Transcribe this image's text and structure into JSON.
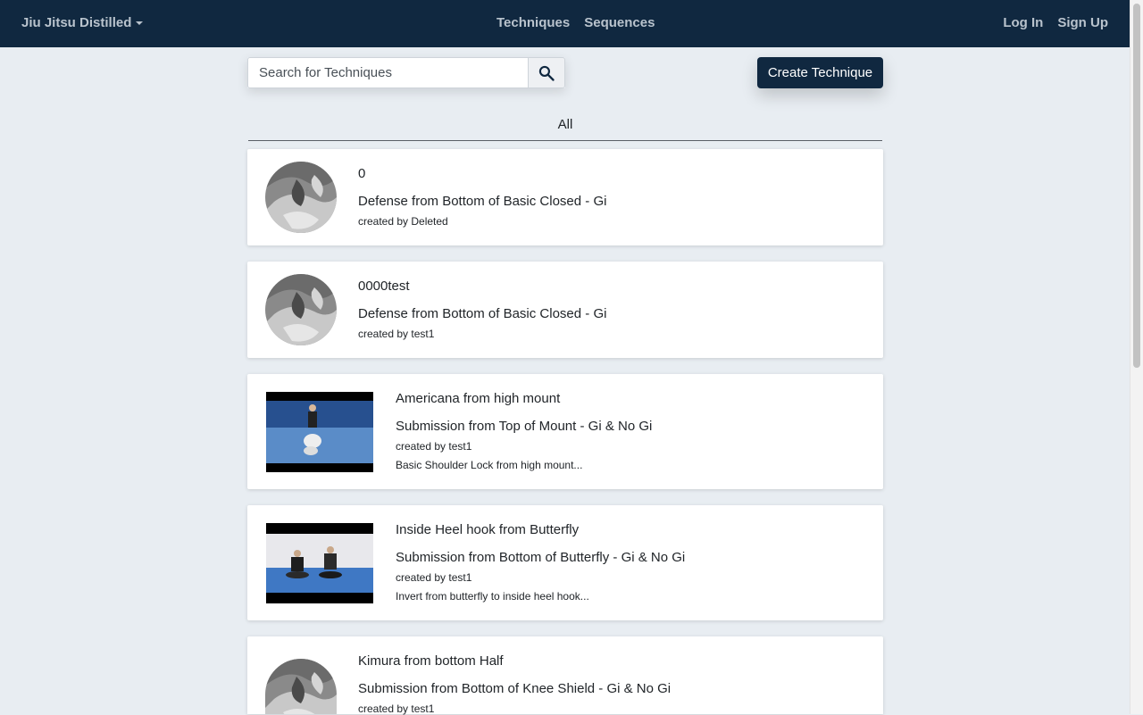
{
  "navbar": {
    "brand": "Jiu Jitsu Distilled",
    "center_links": [
      "Techniques",
      "Sequences"
    ],
    "right_links": [
      "Log In",
      "Sign Up"
    ],
    "bg_color": "#102840"
  },
  "search": {
    "placeholder": "Search for Techniques",
    "button_icon": "search-icon"
  },
  "create_button": "Create Technique",
  "filter_tab": "All",
  "techniques": [
    {
      "name": "0",
      "category": "Defense from Bottom of Basic Closed - Gi",
      "created_by": "created by Deleted",
      "description": "",
      "thumbnail": "grayscale-avatar"
    },
    {
      "name": "0000test",
      "category": "Defense from Bottom of Basic Closed - Gi",
      "created_by": "created by test1",
      "description": "",
      "thumbnail": "grayscale-avatar"
    },
    {
      "name": "Americana from high mount",
      "category": "Submission from Top of Mount - Gi & No Gi",
      "created_by": "created by test1",
      "description": "Basic Shoulder Lock from high mount...",
      "thumbnail": "video-thumbnail"
    },
    {
      "name": "Inside Heel hook from Butterfly",
      "category": "Submission from Bottom of Butterfly - Gi & No Gi",
      "created_by": "created by test1",
      "description": "Invert from butterfly to inside heel hook...",
      "thumbnail": "video-thumbnail"
    },
    {
      "name": "Kimura from bottom Half",
      "category": "Submission from Bottom of Knee Shield - Gi & No Gi",
      "created_by": "created by test1",
      "description": "",
      "thumbnail": "grayscale-avatar"
    }
  ]
}
